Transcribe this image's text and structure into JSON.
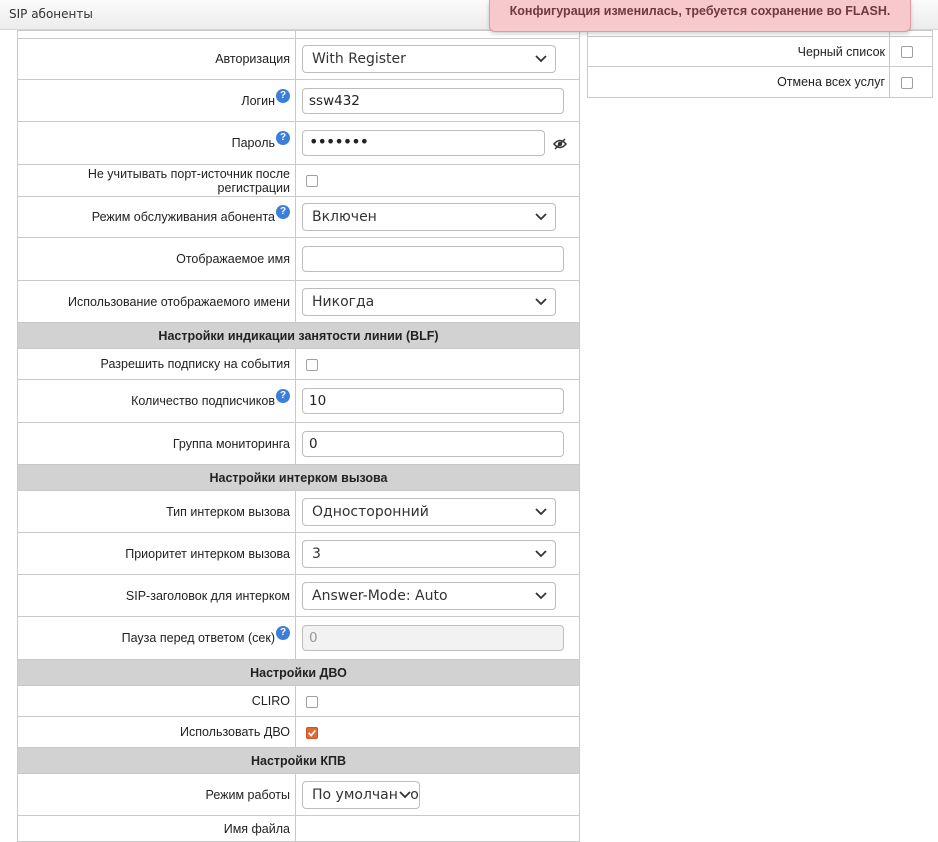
{
  "window": {
    "title": "SIP абоненты"
  },
  "notification": {
    "text": "Конфигурация изменилась, требуется сохранение во FLASH."
  },
  "form": {
    "auth": {
      "label": "Авторизация",
      "value": "With Register"
    },
    "login": {
      "label": "Логин",
      "value": "ssw432"
    },
    "password": {
      "label": "Пароль",
      "masked": "•••••••"
    },
    "ignore_src_port": {
      "label": "Не учитывать порт-источник после регистрации",
      "checked": false
    },
    "service_mode": {
      "label": "Режим обслуживания абонента",
      "value": "Включен"
    },
    "display_name": {
      "label": "Отображаемое имя",
      "value": ""
    },
    "display_name_usage": {
      "label": "Использование отображаемого имени",
      "value": "Никогда"
    },
    "blf_section": "Настройки индикации занятости линии (BLF)",
    "allow_subscribe": {
      "label": "Разрешить подписку на события",
      "checked": false
    },
    "subscribers_count": {
      "label": "Количество подписчиков",
      "value": "10"
    },
    "monitoring_group": {
      "label": "Группа мониторинга",
      "value": "0"
    },
    "intercom_section": "Настройки интерком вызова",
    "intercom_type": {
      "label": "Тип интерком вызова",
      "value": "Односторонний"
    },
    "intercom_priority": {
      "label": "Приоритет интерком вызова",
      "value": "3"
    },
    "intercom_sip_header": {
      "label": "SIP-заголовок для интерком",
      "value": "Answer-Mode: Auto"
    },
    "answer_pause": {
      "label": "Пауза перед ответом (сек)",
      "value": "0"
    },
    "dvo_section": "Настройки ДВО",
    "cliro": {
      "label": "CLIRO",
      "checked": false
    },
    "use_dvo": {
      "label": "Использовать ДВО",
      "checked": true
    },
    "kpv_section": "Настройки КПВ",
    "work_mode": {
      "label": "Режим работы",
      "value": "По умолчанию"
    },
    "file_name": {
      "label": "Имя файла"
    }
  },
  "services": {
    "blacklist": {
      "label": "Черный список",
      "checked": false
    },
    "cancel_all": {
      "label": "Отмена всех услуг",
      "checked": false
    }
  },
  "colors": {
    "accent_checkbox": "#e06a35",
    "help_icon": "#3b7fd9",
    "section_header": "#d2d2d2",
    "toast_bg": "#f7c9cc"
  }
}
